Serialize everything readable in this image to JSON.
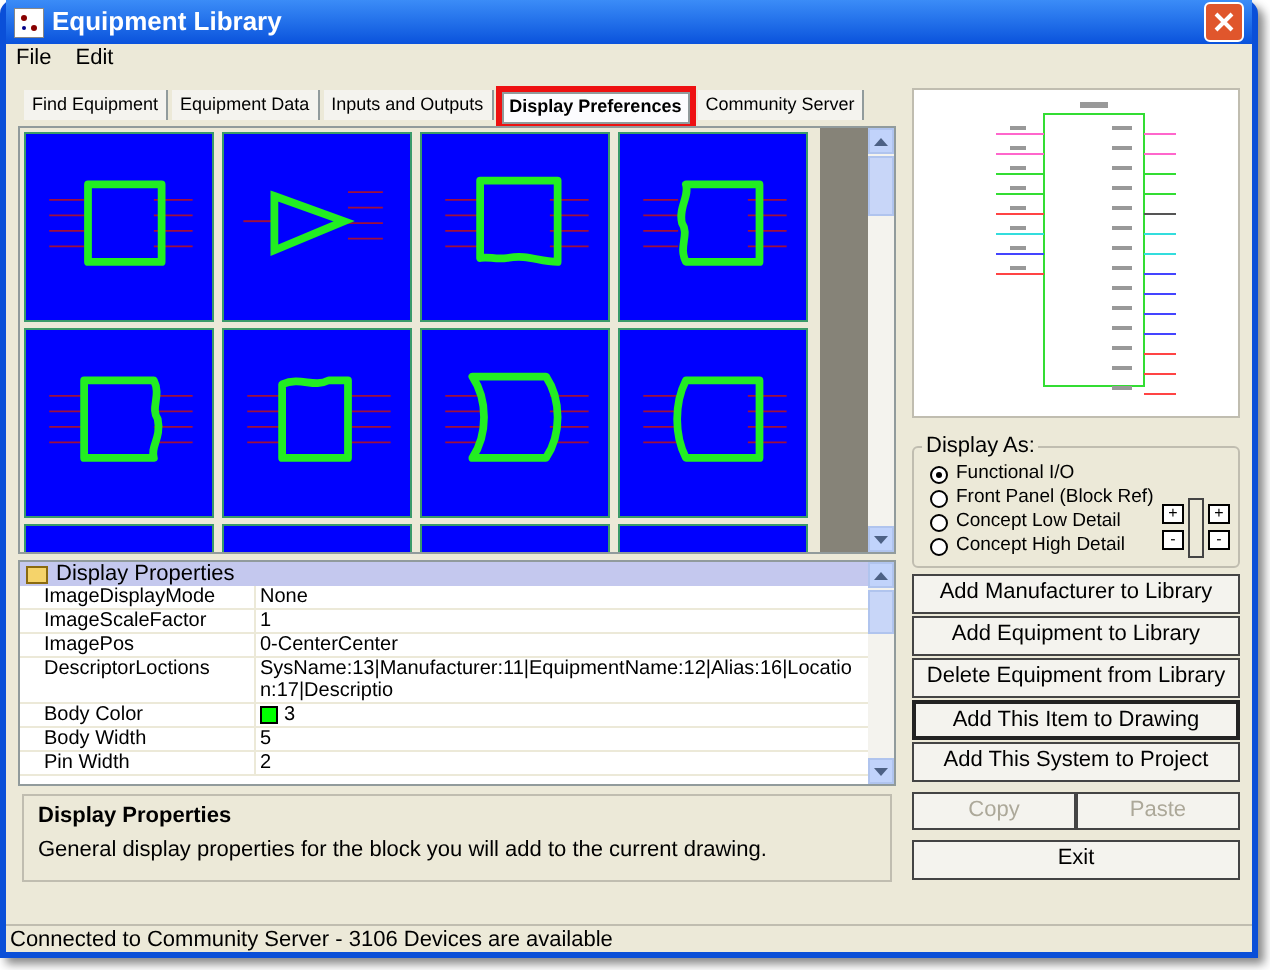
{
  "window": {
    "title": "Equipment Library"
  },
  "menu": [
    "File",
    "Edit"
  ],
  "tabs": [
    {
      "label": "Find Equipment",
      "selected": false,
      "highlighted": false
    },
    {
      "label": "Equipment Data",
      "selected": false,
      "highlighted": false
    },
    {
      "label": "Inputs and Outputs",
      "selected": false,
      "highlighted": false
    },
    {
      "label": "Display Preferences",
      "selected": true,
      "highlighted": true
    },
    {
      "label": "Community Server",
      "selected": false,
      "highlighted": false
    }
  ],
  "properties": {
    "category": "Display Properties",
    "rows": [
      {
        "name": "ImageDisplayMode",
        "value": "None"
      },
      {
        "name": "ImageScaleFactor",
        "value": "1"
      },
      {
        "name": "ImagePos",
        "value": "0-CenterCenter"
      },
      {
        "name": "DescriptorLoctions",
        "value": "SysName:13|Manufacturer:11|EquipmentName:12|Alias:16|Location:17|Descriptio"
      },
      {
        "name": "Body Color",
        "value": "3",
        "color": "#00ff00"
      },
      {
        "name": "Body Width",
        "value": "5"
      },
      {
        "name": "Pin Width",
        "value": "2"
      }
    ]
  },
  "description": {
    "title": "Display Properties",
    "text": "General display properties for the block you will add to the current drawing."
  },
  "display_as": {
    "legend": "Display As:",
    "options": [
      {
        "label": "Functional I/O",
        "selected": true
      },
      {
        "label": "Front Panel (Block Ref)",
        "selected": false
      },
      {
        "label": "Concept Low Detail",
        "selected": false
      },
      {
        "label": "Concept High Detail",
        "selected": false
      }
    ],
    "controls": [
      "+",
      "-",
      "+",
      "-"
    ]
  },
  "buttons": [
    {
      "label": "Add Manufacturer to Library",
      "default": false
    },
    {
      "label": "Add Equipment to Library",
      "default": false
    },
    {
      "label": "Delete Equipment from Library",
      "default": false
    },
    {
      "label": "Add This Item to Drawing",
      "default": true
    },
    {
      "label": "Add This System to Project",
      "default": false
    }
  ],
  "clipboard": [
    {
      "label": "Copy",
      "disabled": true
    },
    {
      "label": "Paste",
      "disabled": true
    }
  ],
  "exit": "Exit",
  "status_bar": "Connected to Community Server - 3106 Devices are available"
}
